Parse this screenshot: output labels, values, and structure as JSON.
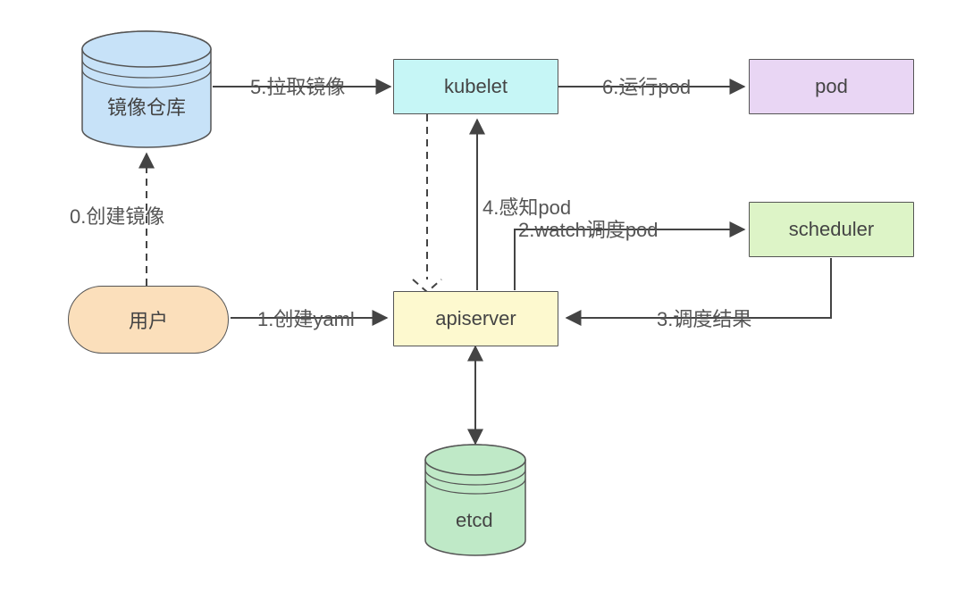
{
  "nodes": {
    "image_repo": "镜像仓库",
    "kubelet": "kubelet",
    "pod": "pod",
    "user": "用户",
    "apiserver": "apiserver",
    "scheduler": "scheduler",
    "etcd": "etcd"
  },
  "edges": {
    "step0": "0.创建镜像",
    "step1": "1.创建yaml",
    "step2": "2.watch调度pod",
    "step3": "3.调度结果",
    "step4": "4.感知pod",
    "step5": "5.拉取镜像",
    "step6": "6.运行pod"
  }
}
